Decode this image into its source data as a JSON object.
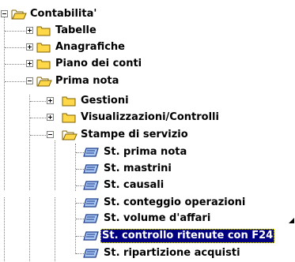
{
  "tree": {
    "root": {
      "label": "Contabilita'",
      "icon": "folder-open-icon",
      "state": "expanded"
    },
    "items": [
      {
        "label": "Tabelle",
        "icon": "folder-icon",
        "state": "collapsed"
      },
      {
        "label": "Anagrafiche",
        "icon": "folder-icon",
        "state": "collapsed"
      },
      {
        "label": "Piano dei conti",
        "icon": "folder-icon",
        "state": "collapsed"
      },
      {
        "label": "Prima nota",
        "icon": "folder-open-icon",
        "state": "expanded"
      },
      {
        "label": "Gestioni",
        "icon": "folder-icon",
        "state": "collapsed"
      },
      {
        "label": "Visualizzazioni/Controlli",
        "icon": "folder-icon",
        "state": "collapsed"
      },
      {
        "label": "Stampe di servizio",
        "icon": "folder-open-icon",
        "state": "expanded"
      },
      {
        "label": "St. prima nota",
        "icon": "report-icon"
      },
      {
        "label": "St. mastrini",
        "icon": "report-icon"
      },
      {
        "label": "St. causali",
        "icon": "report-icon"
      },
      {
        "label": "St. conteggio operazioni",
        "icon": "report-icon"
      },
      {
        "label": "St. volume d'affari",
        "icon": "report-icon"
      },
      {
        "label": "St. controllo ritenute con F24",
        "icon": "report-icon",
        "selected": true
      },
      {
        "label": "St. ripartizione acquisti",
        "icon": "report-icon"
      }
    ]
  },
  "colors": {
    "selection": "#000080",
    "folder": "#ffd84a",
    "report": "#4a78c8"
  }
}
